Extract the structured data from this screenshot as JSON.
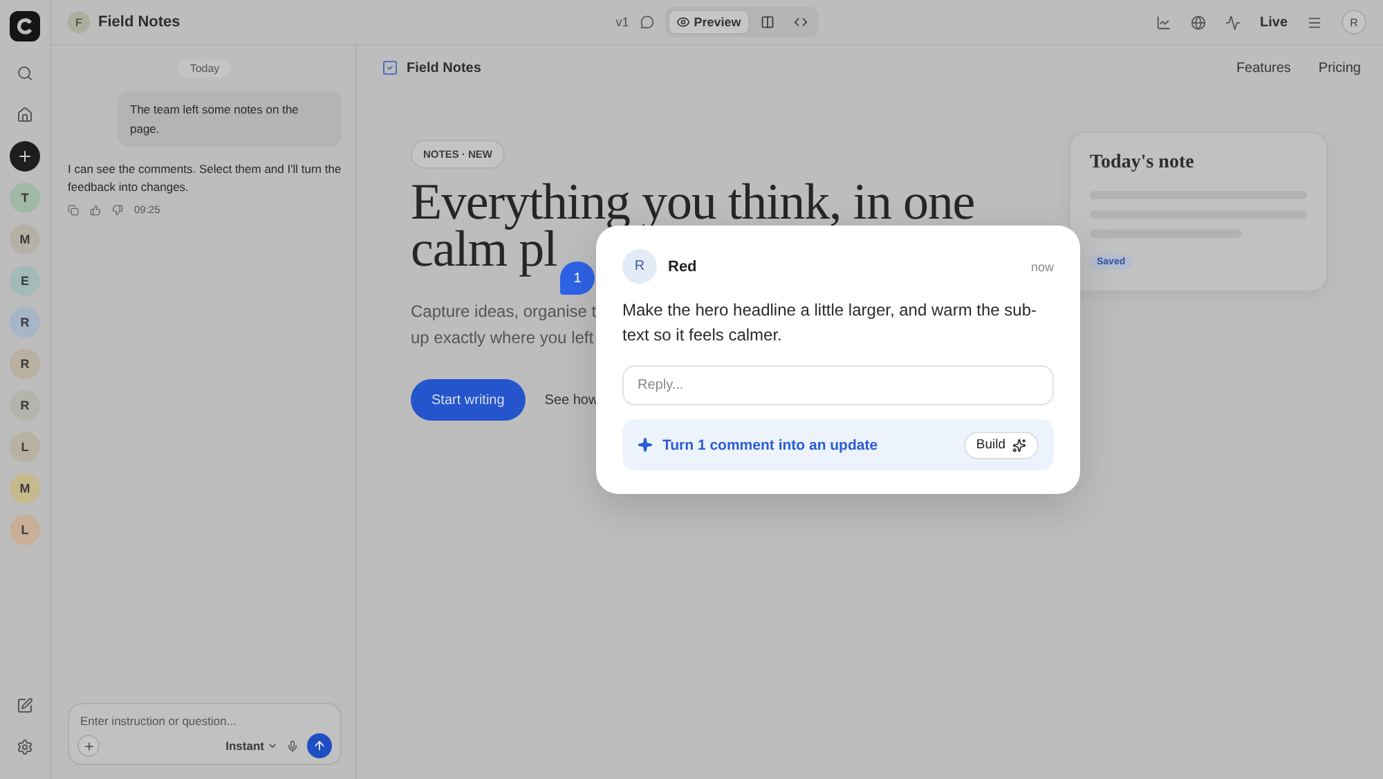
{
  "rail": {
    "avatars": [
      {
        "initial": "T",
        "color": "#9fb9a6"
      },
      {
        "initial": "M",
        "color": "#b6b1a6"
      },
      {
        "initial": "E",
        "color": "#a3bbb6"
      },
      {
        "initial": "R",
        "color": "#a7b5c8"
      },
      {
        "initial": "R",
        "color": "#b9b0a1"
      },
      {
        "initial": "R",
        "color": "#b4b4ad"
      },
      {
        "initial": "L",
        "color": "#b9b2a2"
      },
      {
        "initial": "M",
        "color": "#c6b98e"
      },
      {
        "initial": "L",
        "color": "#c9ae98"
      }
    ]
  },
  "header": {
    "project_initial": "F",
    "project_name": "Field Notes",
    "version": "v1",
    "view_tabs": [
      {
        "kind": "preview",
        "label": "Preview",
        "selected": true
      },
      {
        "kind": "split",
        "selected": false
      },
      {
        "kind": "code",
        "selected": false
      }
    ],
    "status": "Live",
    "user_initial": "R"
  },
  "chat": {
    "date": "Today",
    "messages": [
      {
        "kind": "user",
        "text": "The team left some notes on the page."
      },
      {
        "kind": "assistant",
        "text": "I can see the comments. Select them and I'll turn the feedback into changes.",
        "time": "09:25"
      }
    ],
    "composer": {
      "placeholder": "Enter instruction or question...",
      "mode": "Instant"
    }
  },
  "preview": {
    "brand": "Field Notes",
    "nav": [
      "Features",
      "Pricing"
    ],
    "tag": "NOTES · NEW",
    "headline_lines": [
      "Everything you think, in one",
      "calm pl"
    ],
    "subtitle_lines": [
      "Capture ideas, organise t",
      "up exactly where you left"
    ],
    "primary_button": "Start writing",
    "secondary_link": "See how",
    "note_card": {
      "title": "Today's note",
      "badge": "Saved"
    }
  },
  "pin": {
    "number": "1"
  },
  "comment": {
    "author_initial": "R",
    "author": "Red",
    "time": "now",
    "text": "Make the hero headline a little larger, and warm the sub-text so it feels calmer.",
    "reply_placeholder": "Reply...",
    "action": "Turn 1 comment into an update",
    "action_button": "Build"
  }
}
